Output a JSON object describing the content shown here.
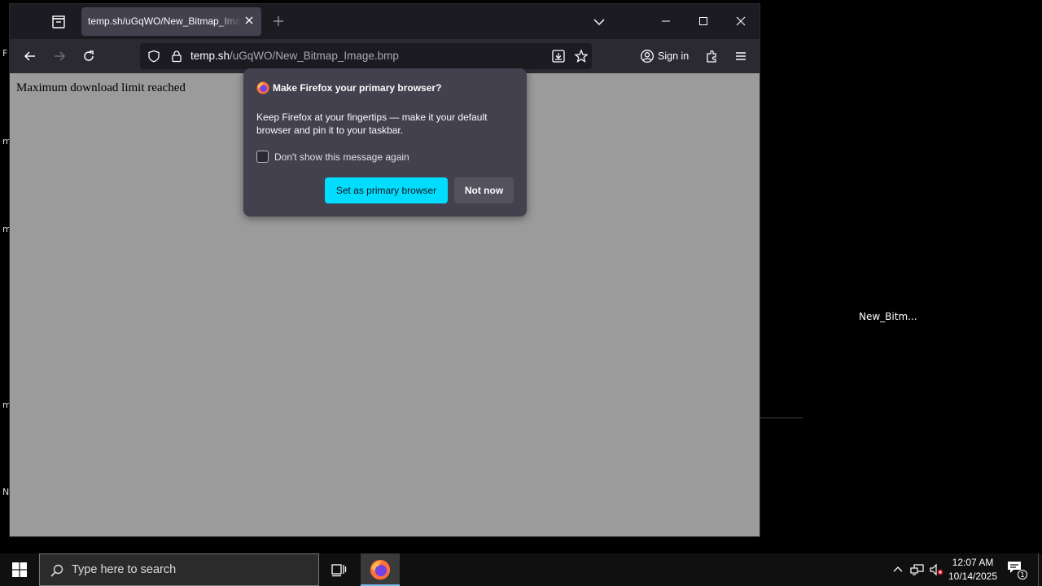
{
  "desktop": {
    "icon_label": "New_Bitm...",
    "partial_labels": [
      "F",
      "m",
      "m",
      "m",
      "N"
    ]
  },
  "browser": {
    "tab": {
      "title": "temp.sh/uGqWO/New_Bitmap_Image.bmp"
    },
    "url": {
      "host": "temp.sh",
      "path": "/uGqWO/New_Bitmap_Image.bmp"
    },
    "signin_label": "Sign in",
    "page_text": "Maximum download limit reached"
  },
  "popup": {
    "title": "Make Firefox your primary browser?",
    "body": "Keep Firefox at your fingertips — make it your default browser and pin it to your taskbar.",
    "checkbox_label": "Don't show this message again",
    "checkbox_checked": false,
    "primary_button": "Set as primary browser",
    "secondary_button": "Not now",
    "accent_color": "#00ddff"
  },
  "taskbar": {
    "search_placeholder": "Type here to search",
    "time": "12:07 AM",
    "date": "10/14/2025",
    "notification_count": "1"
  }
}
